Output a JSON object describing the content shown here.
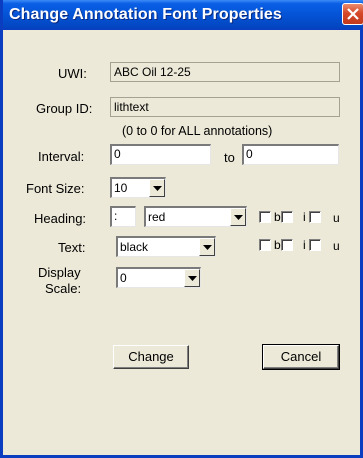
{
  "window": {
    "title": "Change Annotation Font Properties"
  },
  "fields": {
    "uwi_label": "UWI:",
    "uwi_value": "ABC Oil 12-25",
    "group_label": "Group ID:",
    "group_value": "lithtext",
    "interval_hint": "(0 to 0 for ALL annotations)",
    "interval_label": "Interval:",
    "interval_from": "0",
    "interval_to_label": "to",
    "interval_to": "0",
    "font_size_label": "Font Size:",
    "font_size_value": "10",
    "heading_label": "Heading:",
    "heading_prefix": ":",
    "heading_color": "red",
    "text_label": "Text:",
    "text_color": "black",
    "display_scale_label_1": "Display",
    "display_scale_label_2": "Scale:",
    "display_scale_value": "0"
  },
  "style_options": {
    "bold": "b",
    "italic": "i",
    "underline": "u"
  },
  "buttons": {
    "change": "Change",
    "cancel": "Cancel"
  }
}
